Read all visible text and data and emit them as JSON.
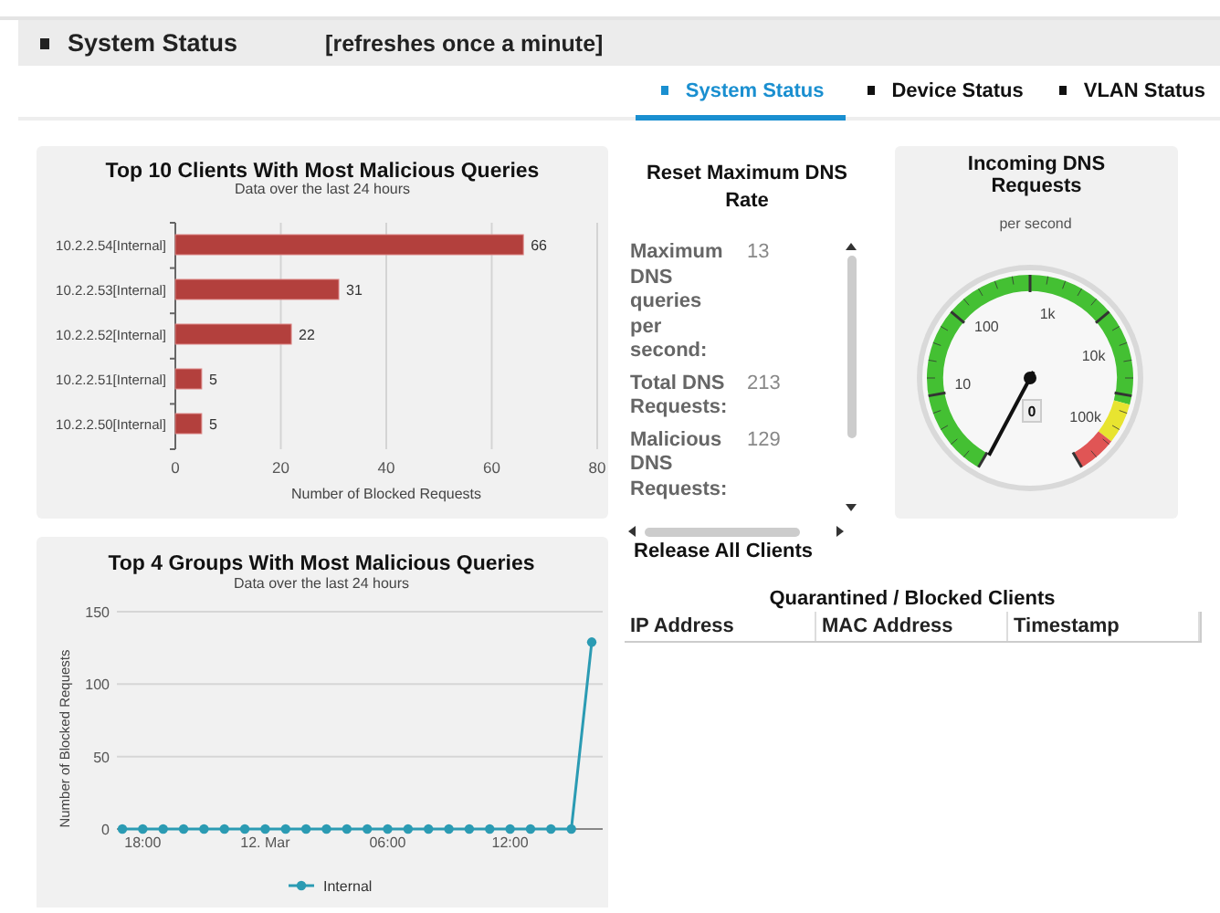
{
  "header": {
    "title": "System Status",
    "note": "[refreshes once a minute]"
  },
  "tabs": [
    {
      "label": "System Status",
      "selected": true
    },
    {
      "label": "Device Status",
      "selected": false
    },
    {
      "label": "VLAN Status",
      "selected": false
    }
  ],
  "clients_panel": {
    "subtitle": "Data over the last 24 hours",
    "chart_data": {
      "type": "bar",
      "orientation": "horizontal",
      "title": "Top 10 Clients With Most Malicious Queries",
      "xlabel": "Number of Blocked Requests",
      "categories": [
        "10.2.2.54[Internal]",
        "10.2.2.53[Internal]",
        "10.2.2.52[Internal]",
        "10.2.2.51[Internal]",
        "10.2.2.50[Internal]"
      ],
      "values": [
        66,
        31,
        22,
        5,
        5
      ],
      "xlim": [
        0,
        80
      ],
      "xticks": [
        0,
        20,
        40,
        60,
        80
      ],
      "grid": true,
      "data_labels": true
    }
  },
  "dns_rate": {
    "title": "Reset Maximum DNS Rate",
    "rows": [
      {
        "label": "Maximum DNS queries per second:",
        "value": "13"
      },
      {
        "label": "Total DNS Requests:",
        "value": "213"
      },
      {
        "label": "Malicious DNS Requests:",
        "value": "129"
      }
    ]
  },
  "gauge": {
    "title": "Incoming DNS Requests",
    "subtitle": "per second",
    "scale_labels": [
      "10",
      "100",
      "1k",
      "10k",
      "100k"
    ],
    "reading": "0"
  },
  "groups_panel": {
    "subtitle": "Data over the last 24 hours",
    "chart_data": {
      "type": "line",
      "title": "Top 4 Groups With Most Malicious Queries",
      "ylabel": "Number of Blocked Requests",
      "categories": [
        null,
        "18:00",
        null,
        null,
        null,
        null,
        null,
        "12. Mar",
        null,
        null,
        null,
        null,
        null,
        "06:00",
        null,
        null,
        null,
        null,
        null,
        "12:00",
        null,
        null,
        null,
        null
      ],
      "series": [
        {
          "name": "Internal",
          "color": "#2b9bb3",
          "marker": true,
          "values": [
            0,
            0,
            0,
            0,
            0,
            0,
            0,
            0,
            0,
            0,
            0,
            0,
            0,
            0,
            0,
            0,
            0,
            0,
            0,
            0,
            0,
            0,
            0,
            129
          ]
        }
      ],
      "ylim": [
        0,
        150
      ],
      "yticks": [
        0,
        50,
        100,
        150
      ],
      "grid": true
    }
  },
  "release_button": "Release All Clients",
  "quarantine_table": {
    "title": "Quarantined / Blocked Clients",
    "columns": [
      "IP Address",
      "MAC Address",
      "Timestamp"
    ]
  }
}
